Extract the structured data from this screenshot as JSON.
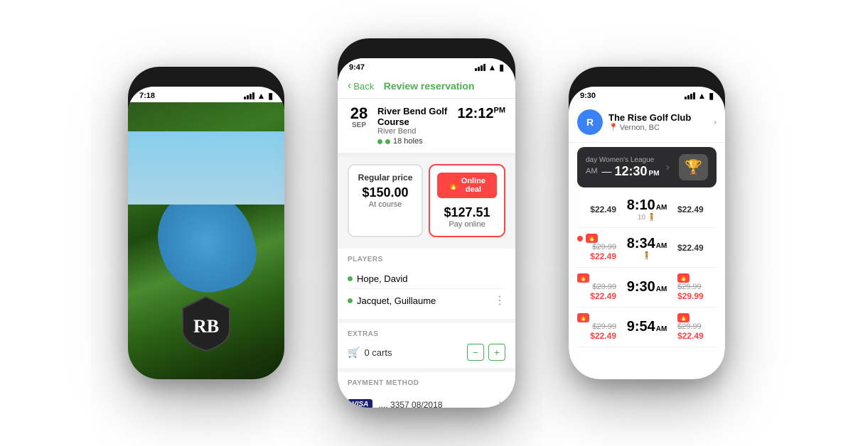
{
  "scene": {
    "bg_color": "#ffffff"
  },
  "phone_left": {
    "status_time": "7:18",
    "logo_initials": "RB",
    "aerial_description": "Golf course aerial view"
  },
  "phone_center": {
    "status_time": "9:47",
    "nav_back": "Back",
    "nav_title": "Review reservation",
    "date_day": "28",
    "date_month": "SEP",
    "course_name": "River Bend Golf Course",
    "course_location": "River Bend",
    "course_holes": "18 holes",
    "tee_time": "12:12",
    "tee_time_period": "PM",
    "regular_price_label": "Regular price",
    "regular_price_amount": "$150.00",
    "regular_price_sub": "At course",
    "online_deal_label": "Online deal",
    "online_deal_amount": "$127.51",
    "online_deal_sub": "Pay online",
    "sections": {
      "players_label": "PLAYERS",
      "players": [
        {
          "name": "Hope, David"
        },
        {
          "name": "Jacquet, Guillaume",
          "has_menu": true
        }
      ],
      "extras_label": "EXTRAS",
      "carts_label": "0 carts",
      "payment_label": "PAYMENT METHOD",
      "visa_label": "VISA",
      "card_details": ".... 3357  08/2018"
    }
  },
  "phone_right": {
    "status_time": "9:30",
    "club_name": "The Rise Golf Club",
    "club_location": "Vernon, BC",
    "league_label": "day Women's League",
    "league_time_start": "AM",
    "league_time_main": "12:30",
    "league_time_period": "PM",
    "tee_times": [
      {
        "price_regular": null,
        "price": "$22.49",
        "time": "8:10",
        "period": "AM",
        "players": "10",
        "price_right": "$22.49",
        "sale": false
      },
      {
        "price_regular": "$29.99",
        "price": "$22.49",
        "time": "8:34",
        "period": "AM",
        "players": "",
        "price_right": "$22.49",
        "sale": true
      },
      {
        "price_regular": "$29.99",
        "price": "$22.49",
        "time": "9:30",
        "period": "AM",
        "players": "",
        "price_right": "$29.99",
        "sale": true
      },
      {
        "price_regular": "$29.99",
        "price": "$22.49",
        "time": "9:54",
        "period": "AM",
        "players": "",
        "price_right": "$22.49",
        "sale": true
      }
    ]
  }
}
